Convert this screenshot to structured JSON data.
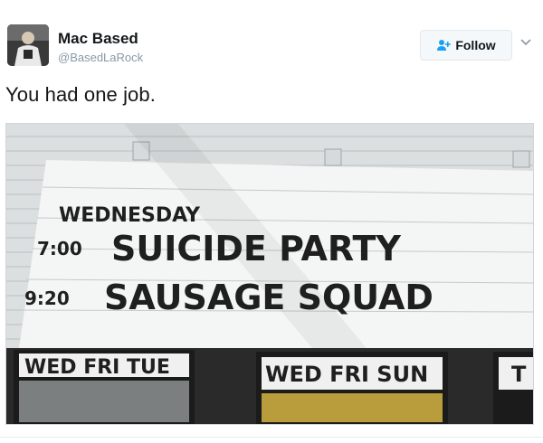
{
  "user": {
    "display_name": "Mac Based",
    "handle": "@BasedLaRock",
    "avatar_icon": "profile-photo"
  },
  "follow": {
    "label": "Follow",
    "icon": "add-user-icon",
    "accent": "#1da1f2"
  },
  "tweet": {
    "text": "You had one job."
  },
  "sign": {
    "line1": "WEDNESDAY",
    "time1": "7:00",
    "title1": "SUICIDE PARTY",
    "time2": "9:20",
    "title2": "SAUSAGE SQUAD",
    "panel_left": "WED FRI TUE",
    "panel_center": "WED FRI SUN",
    "panel_right": "T"
  }
}
